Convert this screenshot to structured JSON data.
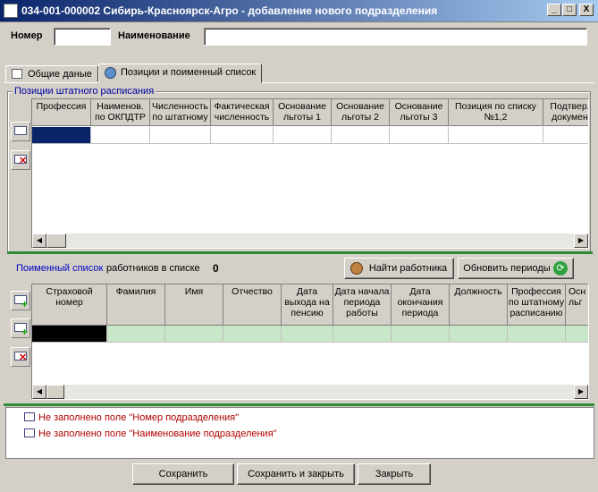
{
  "window": {
    "title": "034-001-000002 Сибирь-Красноярск-Агро - добавление нового подразделения",
    "min": "_",
    "max": "□",
    "close": "X"
  },
  "form": {
    "number_label": "Номер",
    "number_value": "",
    "name_label": "Наименование",
    "name_value": ""
  },
  "tabs": [
    {
      "label": "Общие даные"
    },
    {
      "label": "Позиции и поименный список"
    }
  ],
  "positions": {
    "group_title": "Позиции штатного расписания",
    "columns": [
      "Профессия",
      "Наименов. по ОКПДТР",
      "Численность по штатному",
      "Фактическая численность",
      "Основание льготы 1",
      "Основание льготы 2",
      "Основание льготы 3",
      "Позиция по списку №1,2",
      "Подтвер. докумен"
    ]
  },
  "employees": {
    "list_link": "Поименный список",
    "count_label": "работников в списке",
    "count": "0",
    "find_button": "Найти работника",
    "refresh_button": "Обновить периоды",
    "columns": [
      "Страховой номер",
      "Фамилия",
      "Имя",
      "Отчество",
      "Дата выхода на пенсию",
      "Дата начала периода работы",
      "Дата окончания периода",
      "Должность",
      "Профессия по штатному расписанию",
      "Осн льг"
    ]
  },
  "messages": [
    "Не заполнено поле \"Номер подразделения\"",
    "Не заполнено поле \"Наименование подразделения\""
  ],
  "footer": {
    "save": "Сохранить",
    "save_close": "Сохранить и закрыть",
    "close": "Закрыть"
  }
}
